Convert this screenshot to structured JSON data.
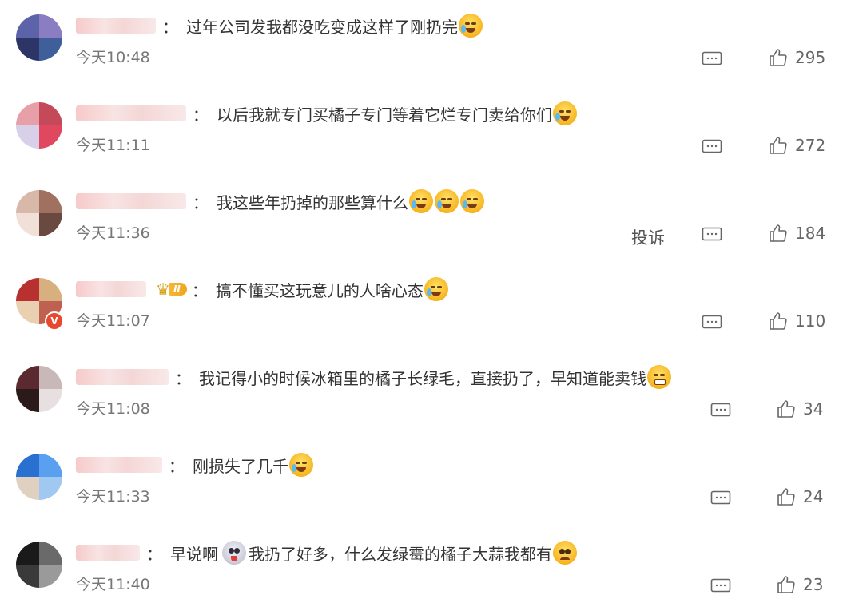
{
  "comments": [
    {
      "name_width": 100,
      "text": "过年公司发我都没吃变成这样了刚扔完",
      "emojis": [
        "cry"
      ],
      "time": "今天10:48",
      "likes": "295",
      "has_report": false,
      "has_vip": false,
      "has_rank": false,
      "avatar_colors": [
        "#5d63a8",
        "#8a7dc1",
        "#2c3566",
        "#3f5f9a"
      ]
    },
    {
      "name_width": 138,
      "text": "以后我就专门买橘子专门等着它烂专门卖给你们",
      "emojis": [
        "cry"
      ],
      "time": "今天11:11",
      "likes": "272",
      "has_report": false,
      "has_vip": false,
      "has_rank": false,
      "avatar_colors": [
        "#e8a0a8",
        "#c44a5a",
        "#d8d0e8",
        "#e04860"
      ]
    },
    {
      "name_width": 138,
      "text": "我这些年扔掉的那些算什么",
      "emojis": [
        "laugh",
        "laugh",
        "laugh"
      ],
      "time": "今天11:36",
      "likes": "184",
      "has_report": true,
      "report_label": "投诉",
      "has_vip": false,
      "has_rank": false,
      "avatar_colors": [
        "#d8b8a8",
        "#a07060",
        "#f0e0d8",
        "#6a4a40"
      ]
    },
    {
      "name_width": 88,
      "text": "搞不懂买这玩意儿的人啥心态",
      "emojis": [
        "laugh"
      ],
      "time": "今天11:07",
      "likes": "110",
      "has_report": false,
      "has_vip": true,
      "has_rank": true,
      "rank_label": "II",
      "avatar_colors": [
        "#b83030",
        "#d8b080",
        "#e8d0b0",
        "#c06050"
      ]
    },
    {
      "name_width": 116,
      "text": "我记得小的时候冰箱里的橘子长绿毛，直接扔了，早知道能卖钱",
      "emojis": [
        "clap"
      ],
      "time": "今天11:08",
      "likes": "34",
      "has_report": false,
      "has_vip": false,
      "has_rank": false,
      "avatar_colors": [
        "#5a2a30",
        "#c8b8b8",
        "#2a1a1a",
        "#e8e0e0"
      ]
    },
    {
      "name_width": 108,
      "text": "刚损失了几千",
      "emojis": [
        "cry"
      ],
      "time": "今天11:33",
      "likes": "24",
      "has_report": false,
      "has_vip": false,
      "has_rank": false,
      "avatar_colors": [
        "#2a70d0",
        "#5aa0f0",
        "#e0d0c0",
        "#a0c8f0"
      ]
    },
    {
      "name_width": 80,
      "text_before": "早说啊",
      "text": "我扔了好多，什么发绿霉的橘子大蒜我都有",
      "emojis": [
        "plead"
      ],
      "mid_emoji": "skull",
      "time": "今天11:40",
      "likes": "23",
      "has_report": false,
      "has_vip": false,
      "has_rank": false,
      "avatar_colors": [
        "#1a1a1a",
        "#6a6a6a",
        "#3a3a3a",
        "#9a9a9a"
      ]
    }
  ],
  "separator": "：",
  "icons": {
    "reply": "reply-comment-icon",
    "like": "thumbs-up-icon"
  }
}
